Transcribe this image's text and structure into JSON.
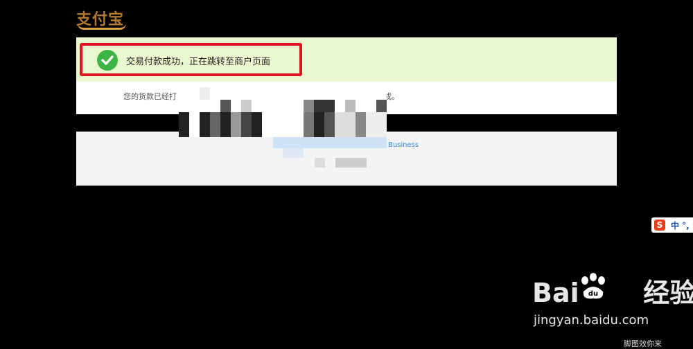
{
  "logo": {
    "text": "支付宝"
  },
  "success": {
    "message": "交易付款成功，正在跳转至商户页面"
  },
  "info": {
    "text_start": "您的货款已经打",
    "text_end": "成。"
  },
  "links": {
    "business": "Business"
  },
  "ime": {
    "text": "中 °,"
  },
  "watermark": {
    "url": "jingyan.baidu.com",
    "bottom_text": "脚图效你来"
  },
  "colors": {
    "success_bg": "#eaf8cf",
    "highlight_border": "#e0141e",
    "check": "#3cb544",
    "link": "#2f8ae5"
  }
}
